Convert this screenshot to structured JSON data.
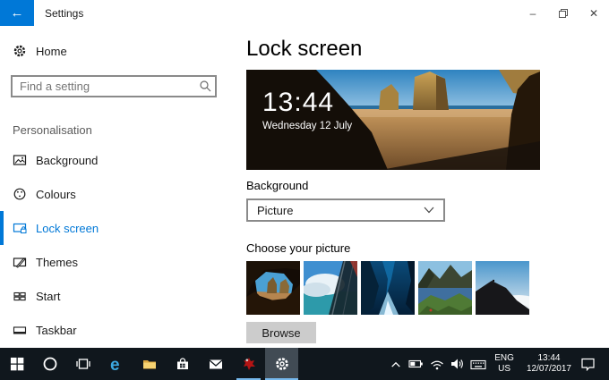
{
  "titlebar": {
    "title": "Settings"
  },
  "icons": {
    "back": "←",
    "minimize": "–",
    "close": "✕",
    "edge_letter": "e"
  },
  "sidebar": {
    "home_label": "Home",
    "search_placeholder": "Find a setting",
    "section_header": "Personalisation",
    "items": [
      {
        "label": "Background",
        "icon": "background-picture-icon",
        "selected": false
      },
      {
        "label": "Colours",
        "icon": "colours-palette-icon",
        "selected": false
      },
      {
        "label": "Lock screen",
        "icon": "lock-screen-icon",
        "selected": true
      },
      {
        "label": "Themes",
        "icon": "themes-icon",
        "selected": false
      },
      {
        "label": "Start",
        "icon": "start-tiles-icon",
        "selected": false
      },
      {
        "label": "Taskbar",
        "icon": "taskbar-icon",
        "selected": false
      }
    ]
  },
  "main": {
    "title": "Lock screen",
    "preview": {
      "time": "13:44",
      "date": "Wednesday 12 July"
    },
    "background_label": "Background",
    "background_value": "Picture",
    "choose_label": "Choose your picture",
    "browse_label": "Browse",
    "thumbnails": [
      "beach-through-cave-arch",
      "sky-clouds-glass-building",
      "blue-ice-cave",
      "mountain-lake-reflection",
      "dark-ridge-above-clouds"
    ]
  },
  "taskbar": {
    "language": {
      "line1": "ENG",
      "line2": "US"
    },
    "clock": {
      "time": "13:44",
      "date": "12/07/2017"
    }
  },
  "colors": {
    "accent": "#0078d7",
    "taskbar_bg": "#10171d",
    "running_underline": "#76b9ed",
    "browse_button_bg": "#cccccc",
    "selected_nav_text": "#0078d7"
  }
}
